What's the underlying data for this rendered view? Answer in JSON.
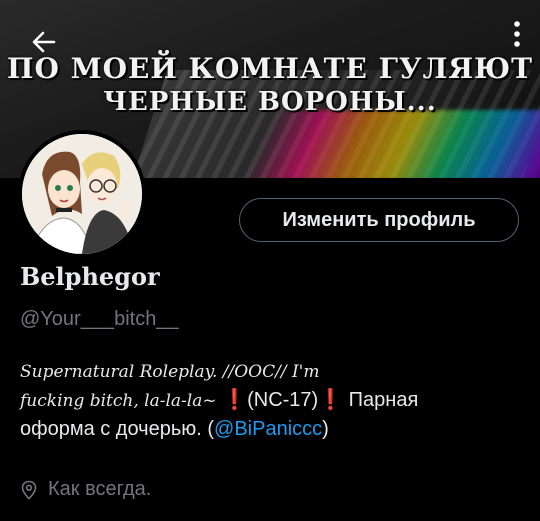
{
  "header": {
    "back_icon": "arrow-left-icon",
    "more_icon": "more-vertical-icon",
    "banner_line1": "ПО МОЕЙ КОМНАТЕ ГУЛЯЮТ",
    "banner_line2": "ЧЕРНЫЕ ВОРОНЫ..."
  },
  "profile": {
    "edit_button": "Изменить профиль",
    "name": "Belphegor",
    "handle": "@Your___bitch__",
    "bio": {
      "line1": "Supernatural Roleplay.  //OOC//  I'm",
      "line2_gothic": "fucking bitch, la-la-la~",
      "warn_left": "❗",
      "rating": "(NC-17)",
      "warn_right": "❗",
      "line2_tail": " Парная",
      "line3_text": "оформа с дочерью. (",
      "mention": "@BiPaniccc",
      "line3_end": ")"
    },
    "location_icon": "location-pin-icon",
    "location": "Как всегда."
  },
  "colors": {
    "background": "#000000",
    "text": "#e7e9ea",
    "muted": "#71767b",
    "link": "#1d9bf0",
    "warning": "#e0245e"
  }
}
